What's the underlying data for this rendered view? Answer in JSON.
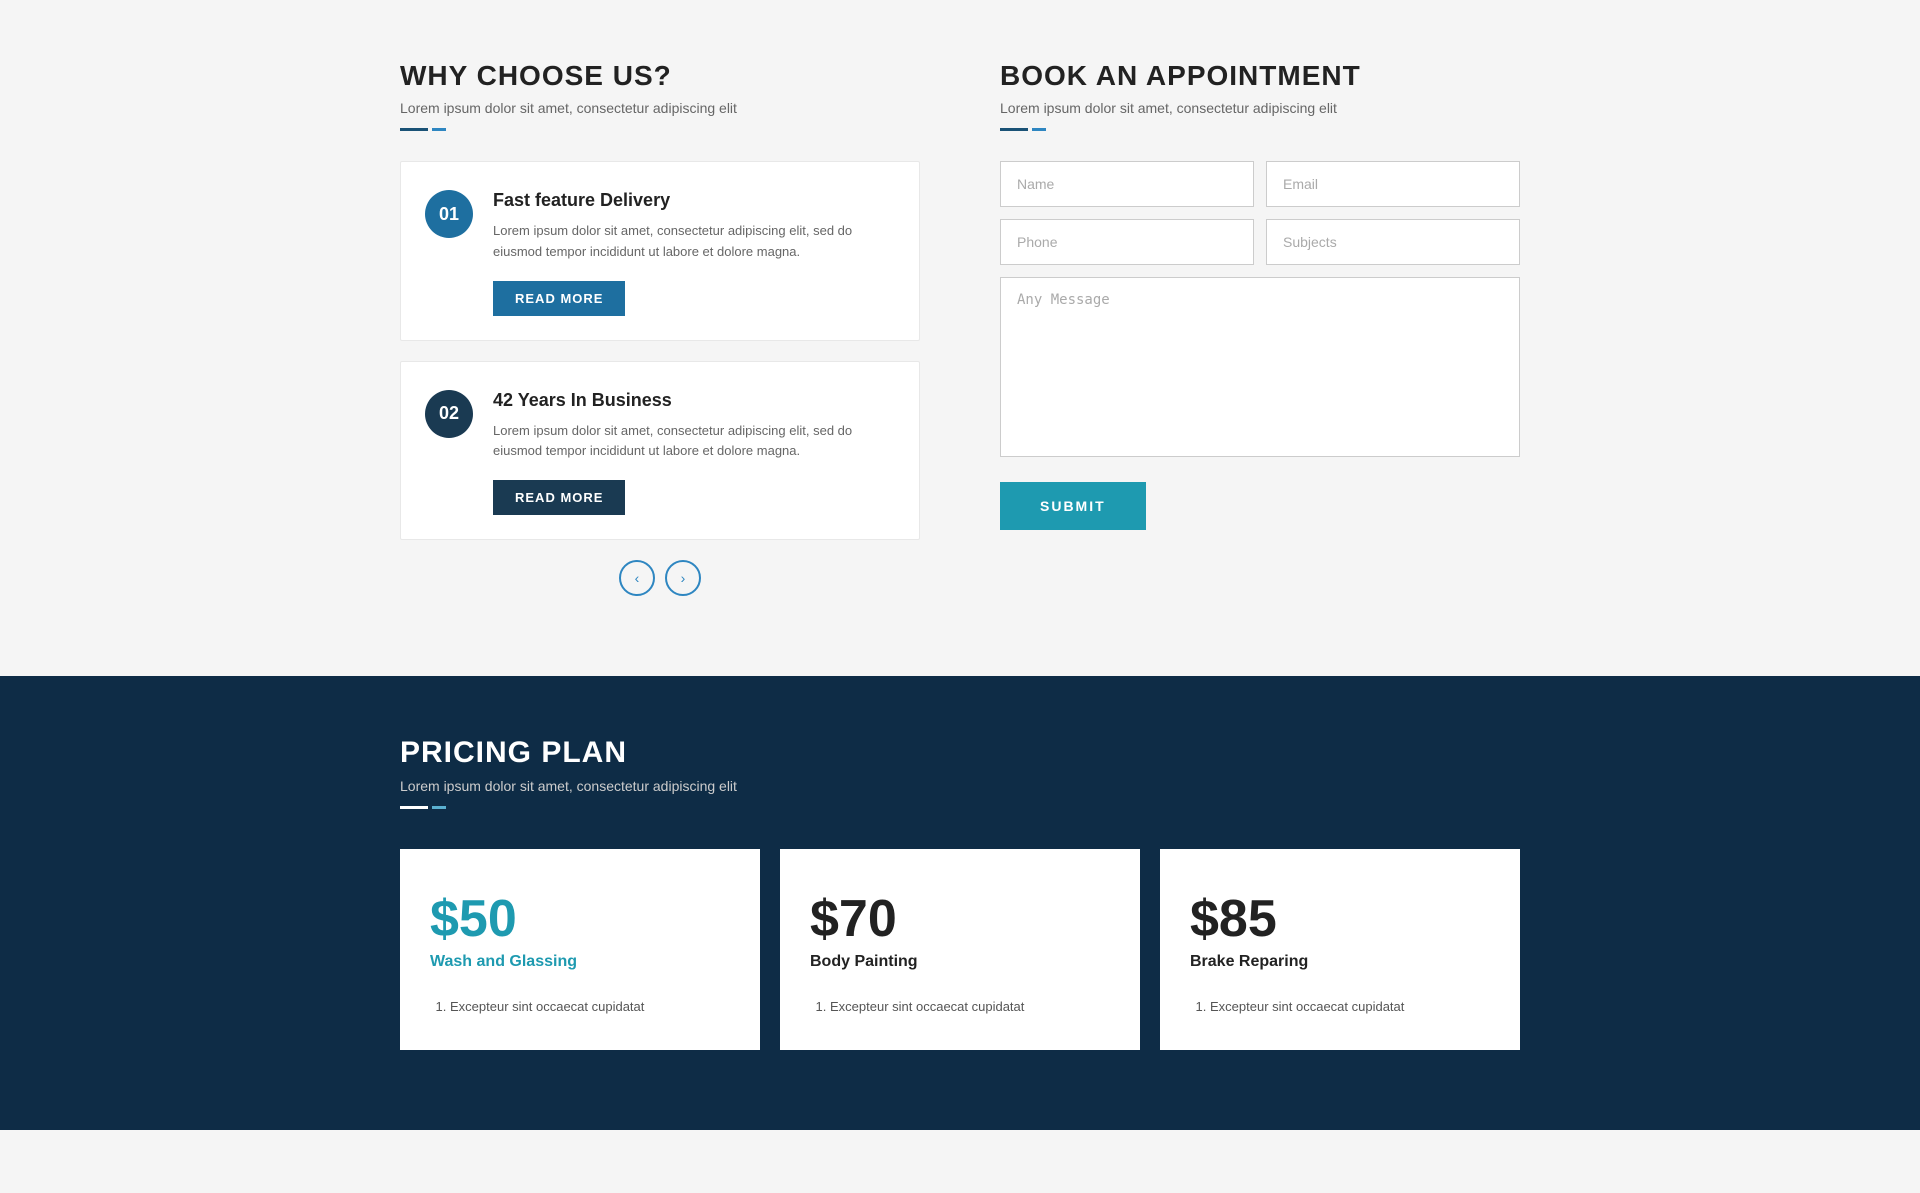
{
  "why_choose": {
    "title": "WHY CHOOSE US?",
    "subtitle": "Lorem ipsum dolor sit amet, consectetur adipiscing elit",
    "features": [
      {
        "number": "01",
        "title": "Fast feature Delivery",
        "description": "Lorem ipsum dolor sit amet, consectetur adipiscing elit, sed do eiusmod tempor incididunt ut labore et dolore magna.",
        "button_label": "READ MORE",
        "style": "light"
      },
      {
        "number": "02",
        "title": "42 Years In Business",
        "description": "Lorem ipsum dolor sit amet, consectetur adipiscing elit, sed do eiusmod tempor incididunt ut labore et dolore magna.",
        "button_label": "READ MORE",
        "style": "dark"
      }
    ]
  },
  "book_appointment": {
    "title": "BOOK AN APPOINTMENT",
    "subtitle": "Lorem ipsum dolor sit amet, consectetur adipiscing elit",
    "form": {
      "name_placeholder": "Name",
      "email_placeholder": "Email",
      "phone_placeholder": "Phone",
      "subjects_placeholder": "Subjects",
      "message_placeholder": "Any Message",
      "submit_label": "SUBMIT"
    }
  },
  "pagination": {
    "prev_label": "‹",
    "next_label": "›"
  },
  "pricing": {
    "title": "PRICING PLAN",
    "subtitle": "Lorem ipsum dolor sit amet, consectetur adipiscing elit",
    "plans": [
      {
        "price": "$50",
        "label": "Wash and Glassing",
        "accent": true,
        "features": [
          "Excepteur sint occaecat cupidatat"
        ]
      },
      {
        "price": "$70",
        "label": "Body Painting",
        "accent": false,
        "features": [
          "Excepteur sint occaecat cupidatat"
        ]
      },
      {
        "price": "$85",
        "label": "Brake Reparing",
        "accent": false,
        "features": [
          "Excepteur sint occaecat cupidatat"
        ]
      }
    ]
  }
}
